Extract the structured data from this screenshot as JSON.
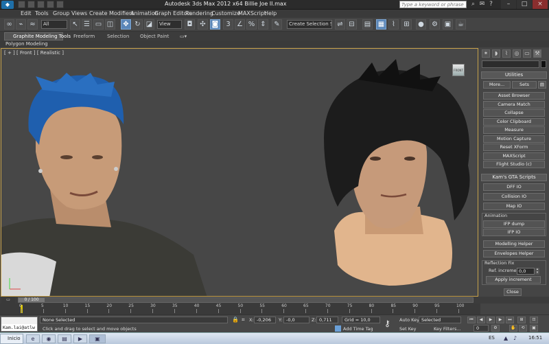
{
  "window": {
    "title": "Autodesk 3ds Max  2012 x64     Billie Joe II.max",
    "search_placeholder": "Type a keyword or phrase"
  },
  "menu": [
    "Edit",
    "Tools",
    "Group",
    "Views",
    "Create",
    "Modifiers",
    "Animation",
    "Graph Editors",
    "Rendering",
    "Customize",
    "MAXScript",
    "Help"
  ],
  "toolbar": {
    "selection_filter": "All",
    "ref_coord": "View",
    "named_selection": "Create Selection Se"
  },
  "ribbon": {
    "tabs": [
      "Graphite Modeling Tools",
      "Freeform",
      "Selection",
      "Object Paint"
    ],
    "panel": "Polygon Modeling"
  },
  "viewport": {
    "label": "[ + ] [ Front ] [ Realistic ]",
    "viewcube_label": "FRONT"
  },
  "command_panel": {
    "utilities": {
      "header": "Utilities",
      "more": "More...",
      "sets": "Sets",
      "buttons": [
        "Asset Browser",
        "Camera Match",
        "Collapse",
        "Color Clipboard",
        "Measure",
        "Motion Capture",
        "Reset XForm",
        "MAXScript",
        "Flight Studio (c)"
      ]
    },
    "gta": {
      "header": "Kam's GTA Scripts",
      "buttons": [
        "DFF IO",
        "Collision IO",
        "Map IO"
      ],
      "animation_label": "Animation",
      "anim_buttons": [
        "IFP dump",
        "IFP IO"
      ],
      "helper_buttons": [
        "Modelling Helper",
        "Envelopes Helper"
      ],
      "reflection_label": "Reflection Fix",
      "ref_increment_label": "Ref. increment",
      "ref_increment_value": "0,0",
      "apply": "Apply increment",
      "close": "Close"
    }
  },
  "timeline": {
    "frame": "0 / 100",
    "ticks": [
      "0",
      "5",
      "10",
      "15",
      "20",
      "25",
      "30",
      "35",
      "40",
      "45",
      "50",
      "55",
      "60",
      "65",
      "70",
      "75",
      "80",
      "85",
      "90",
      "95",
      "100"
    ]
  },
  "status": {
    "maxscript_text": "Kam.lai@atlw",
    "selection": "None Selected",
    "prompt": "Click and drag to select and move objects",
    "x_label": "X:",
    "x_value": "-0,206",
    "y_label": "Y:",
    "y_value": "-0,0",
    "z_label": "Z:",
    "z_value": "0,711",
    "grid": "Grid = 10,0",
    "add_time_tag": "Add Time Tag",
    "auto_key": "Auto Key",
    "set_key": "Set Key",
    "key_mode": "Selected",
    "key_filters": "Key Filters...",
    "frame_value": "0"
  },
  "taskbar": {
    "start": "Inicio",
    "language": "ES",
    "clock": "16:51"
  },
  "colors": {
    "accent": "#5a86b8",
    "viewport_border": "#c8a24b",
    "hair_blue": "#1f5fae"
  }
}
